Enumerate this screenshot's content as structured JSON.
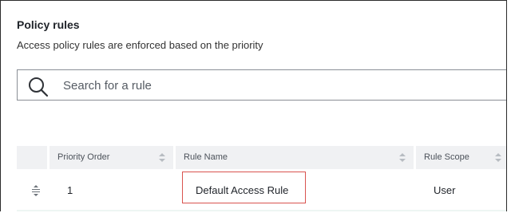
{
  "section": {
    "title": "Policy rules",
    "subtitle": "Access policy rules are enforced based on the priority"
  },
  "search": {
    "placeholder": "Search for a rule"
  },
  "table": {
    "columns": [
      "Priority Order",
      "Rule Name",
      "Rule Scope"
    ],
    "rows": [
      {
        "priority": "1",
        "name": "Default Access Rule",
        "scope": "User"
      }
    ]
  },
  "icons": {
    "search": "search-icon",
    "drag": "drag-handle-icon",
    "sort": "sort-icon"
  },
  "colors": {
    "header_bg": "#f0f1f3",
    "highlight_border": "#d9534f"
  }
}
